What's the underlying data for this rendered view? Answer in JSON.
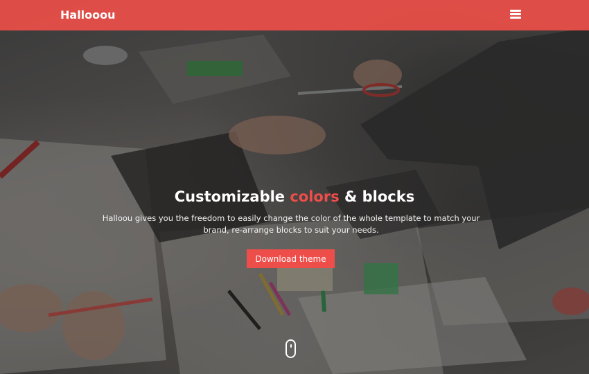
{
  "navbar": {
    "brand": "Hallooou",
    "menu_icon": "hamburger-menu-icon"
  },
  "hero": {
    "headline_part1": "Customizable ",
    "headline_accent": "colors",
    "headline_part2": " & blocks",
    "subtitle": "Halloou gives you the freedom to easily change the color of the whole template to match your brand, re-arrange blocks to suit your needs.",
    "cta_label": "Download theme",
    "scroll_icon": "mouse-scroll-icon"
  },
  "colors": {
    "accent": "#ee4e4a",
    "navbar": "#ec4e48",
    "text": "#ffffff"
  }
}
